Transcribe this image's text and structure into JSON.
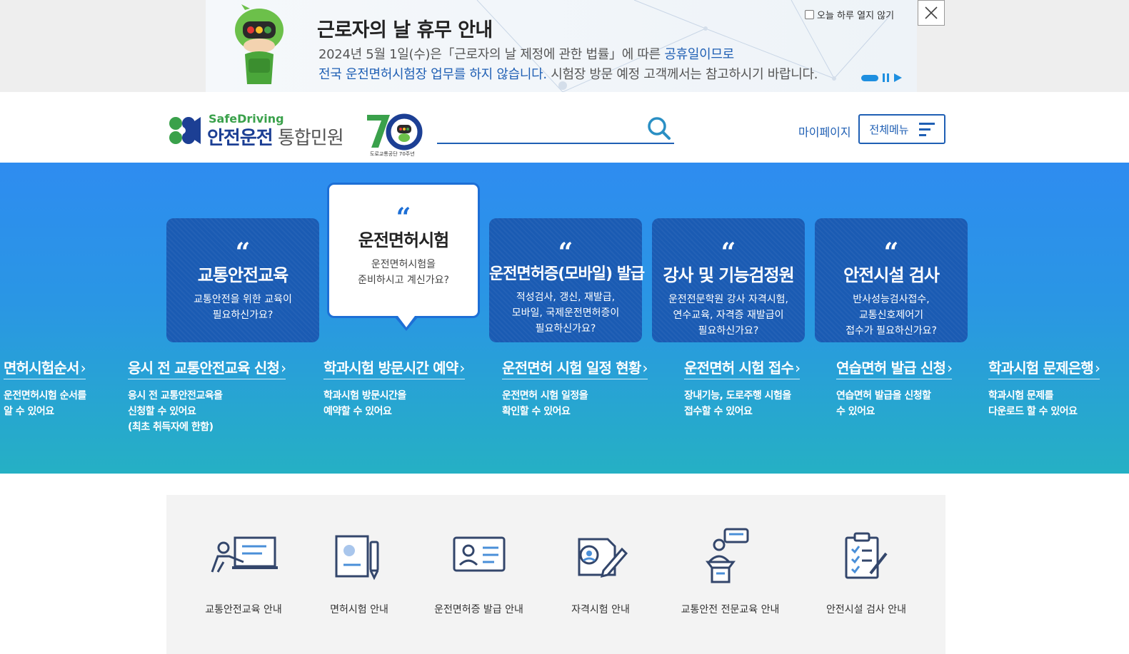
{
  "banner": {
    "title": "근로자의 날 휴무 안내",
    "line1_a": "2024년 5월 1일(수)은「근로자의 날 제정에 관한 법률」에 따른 ",
    "line1_b": "공휴일이므로",
    "line2_a": "전국 운전면허시험장 업무를 하지 않습니다.",
    "line2_b": " 시험장 방문 예정 고객께서는 참고하시기 바랍니다.",
    "checkbox_label": "오늘 하루 열지 않기"
  },
  "header": {
    "logo_en": "SafeDriving",
    "logo_ko_a": "안전운전",
    "logo_ko_b": " 통합민원",
    "anniv_caption": "도로교통공단 70주년",
    "search_placeholder": "",
    "mypage": "마이페이지",
    "all_menu": "전체메뉴"
  },
  "cards": [
    {
      "title": "교통안전교육",
      "desc1": "교통안전을 위한 교육이",
      "desc2": "필요하신가요?",
      "desc3": ""
    },
    {
      "title": "운전면허시험",
      "desc1": "운전면허시험을",
      "desc2": "준비하시고 계신가요?",
      "desc3": ""
    },
    {
      "title": "운전면허증(모바일) 발급",
      "desc1": "적성검사, 갱신, 재발급,",
      "desc2": "모바일, 국제운전면허증이",
      "desc3": "필요하신가요?"
    },
    {
      "title": "강사 및 기능검정원",
      "desc1": "운전전문학원 강사 자격시험,",
      "desc2": "연수교육, 자격증 재발급이",
      "desc3": "필요하신가요?"
    },
    {
      "title": "안전시설 검사",
      "desc1": "반사성능검사접수,",
      "desc2": "교통신호제어기",
      "desc3": "접수가 필요하신가요?"
    }
  ],
  "quote_mark": "“",
  "quick_links": [
    {
      "title": "면허시험순서",
      "d1": "운전면허시험 순서를",
      "d2": "알 수 있어요",
      "d3": ""
    },
    {
      "title": "응시 전 교통안전교육 신청",
      "d1": "응시 전 교통안전교육을",
      "d2": "신청할 수 있어요",
      "d3": "(최초 취득자에 한함)"
    },
    {
      "title": "학과시험 방문시간 예약",
      "d1": "학과시험 방문시간을",
      "d2": "예약할 수 있어요",
      "d3": ""
    },
    {
      "title": "운전면허 시험 일정 현황",
      "d1": "운전면허 시험 일정을",
      "d2": "확인할 수 있어요",
      "d3": ""
    },
    {
      "title": "운전면허 시험 접수",
      "d1": "장내기능, 도로주행 시험을",
      "d2": "접수할 수 있어요",
      "d3": ""
    },
    {
      "title": "연습면허 발급 신청",
      "d1": "연습면허 발급을 신청할",
      "d2": "수 있어요",
      "d3": ""
    },
    {
      "title": "학과시험 문제은행",
      "d1": "학과시험 문제를",
      "d2": "다운로드 할 수 있어요",
      "d3": ""
    }
  ],
  "arrow": "›",
  "guides": [
    {
      "label": "교통안전교육 안내",
      "icon": "lecture-icon"
    },
    {
      "label": "면허시험 안내",
      "icon": "exam-document-icon"
    },
    {
      "label": "운전면허증 발급 안내",
      "icon": "id-card-icon"
    },
    {
      "label": "자격시험 안내",
      "icon": "certificate-search-icon"
    },
    {
      "label": "교통안전 전문교육 안내",
      "icon": "podium-speaker-icon"
    },
    {
      "label": "안전시설 검사 안내",
      "icon": "checklist-icon"
    }
  ],
  "colors": {
    "primary": "#1f5fb4",
    "card": "#1a5bb3",
    "hero_top": "#2e8cf0",
    "hero_bottom": "#25b0c4",
    "green": "#3aa14b"
  }
}
